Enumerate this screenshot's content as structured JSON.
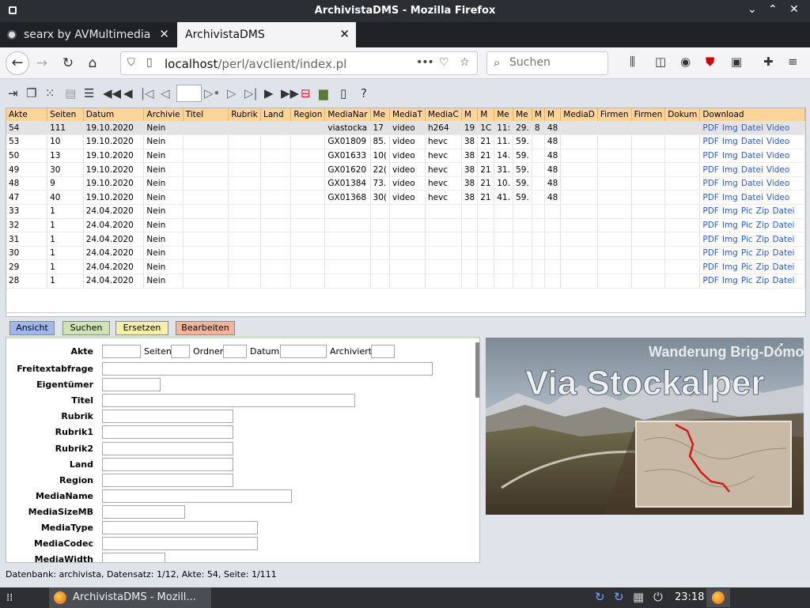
{
  "window": {
    "title": "ArchivistaDMS - Mozilla Firefox"
  },
  "tabs": [
    {
      "label": "searx by AVMultimedia",
      "active": false
    },
    {
      "label": "ArchivistaDMS",
      "active": true
    }
  ],
  "navbar": {
    "url_host": "localhost",
    "url_path": "/perl/avclient/index.pl",
    "search_placeholder": "Suchen",
    "more_label": "•••"
  },
  "toolbar": {
    "page_value": "",
    "help_label": "?"
  },
  "grid": {
    "columns": [
      "Akte",
      "Seiten",
      "Datum",
      "Archivie",
      "Titel",
      "Rubrik",
      "Land",
      "Region",
      "MediaNar",
      "Me",
      "MediaT",
      "MediaC",
      "M",
      "M",
      "Me",
      "Me",
      "M",
      "M",
      "MediaD",
      "Firmen",
      "Firmen",
      "Dokum",
      "Download"
    ],
    "rows": [
      {
        "selected": true,
        "cells": [
          "54",
          "111",
          "19.10.2020",
          "Nein",
          "",
          "",
          "",
          "",
          "viastocka",
          "17",
          "video",
          "h264",
          "19",
          "1C",
          "11:",
          "29.",
          "8",
          "48",
          "",
          "",
          "",
          ""
        ],
        "links": [
          "PDF",
          "Img",
          "Datei",
          "Video"
        ]
      },
      {
        "selected": false,
        "cells": [
          "53",
          "10",
          "19.10.2020",
          "Nein",
          "",
          "",
          "",
          "",
          "GX01809",
          "85.",
          "video",
          "hevc",
          "38",
          "21",
          "11.",
          "59.",
          "",
          "48",
          "",
          "",
          "",
          ""
        ],
        "links": [
          "PDF",
          "Img",
          "Datei",
          "Video"
        ]
      },
      {
        "selected": false,
        "cells": [
          "50",
          "13",
          "19.10.2020",
          "Nein",
          "",
          "",
          "",
          "",
          "GX01633",
          "10(",
          "video",
          "hevc",
          "38",
          "21",
          "14.",
          "59.",
          "",
          "48",
          "",
          "",
          "",
          ""
        ],
        "links": [
          "PDF",
          "Img",
          "Datei",
          "Video"
        ]
      },
      {
        "selected": false,
        "cells": [
          "49",
          "30",
          "19.10.2020",
          "Nein",
          "",
          "",
          "",
          "",
          "GX01620",
          "22(",
          "video",
          "hevc",
          "38",
          "21",
          "31.",
          "59.",
          "",
          "48",
          "",
          "",
          "",
          ""
        ],
        "links": [
          "PDF",
          "Img",
          "Datei",
          "Video"
        ]
      },
      {
        "selected": false,
        "cells": [
          "48",
          "9",
          "19.10.2020",
          "Nein",
          "",
          "",
          "",
          "",
          "GX01384",
          "73.",
          "video",
          "hevc",
          "38",
          "21",
          "10.",
          "59.",
          "",
          "48",
          "",
          "",
          "",
          ""
        ],
        "links": [
          "PDF",
          "Img",
          "Datei",
          "Video"
        ]
      },
      {
        "selected": false,
        "cells": [
          "47",
          "40",
          "19.10.2020",
          "Nein",
          "",
          "",
          "",
          "",
          "GX01368",
          "30(",
          "video",
          "hevc",
          "38",
          "21",
          "41.",
          "59.",
          "",
          "48",
          "",
          "",
          "",
          ""
        ],
        "links": [
          "PDF",
          "Img",
          "Datei",
          "Video"
        ]
      },
      {
        "selected": false,
        "cells": [
          "33",
          "1",
          "24.04.2020",
          "Nein",
          "",
          "",
          "",
          "",
          "",
          "",
          "",
          "",
          "",
          "",
          "",
          "",
          "",
          "",
          "",
          "",
          "",
          ""
        ],
        "links": [
          "PDF",
          "Img",
          "Pic",
          "Zip",
          "Datei"
        ]
      },
      {
        "selected": false,
        "cells": [
          "32",
          "1",
          "24.04.2020",
          "Nein",
          "",
          "",
          "",
          "",
          "",
          "",
          "",
          "",
          "",
          "",
          "",
          "",
          "",
          "",
          "",
          "",
          "",
          ""
        ],
        "links": [
          "PDF",
          "Img",
          "Pic",
          "Zip",
          "Datei"
        ]
      },
      {
        "selected": false,
        "cells": [
          "31",
          "1",
          "24.04.2020",
          "Nein",
          "",
          "",
          "",
          "",
          "",
          "",
          "",
          "",
          "",
          "",
          "",
          "",
          "",
          "",
          "",
          "",
          "",
          ""
        ],
        "links": [
          "PDF",
          "Img",
          "Pic",
          "Zip",
          "Datei"
        ]
      },
      {
        "selected": false,
        "cells": [
          "30",
          "1",
          "24.04.2020",
          "Nein",
          "",
          "",
          "",
          "",
          "",
          "",
          "",
          "",
          "",
          "",
          "",
          "",
          "",
          "",
          "",
          "",
          "",
          ""
        ],
        "links": [
          "PDF",
          "Img",
          "Pic",
          "Zip",
          "Datei"
        ]
      },
      {
        "selected": false,
        "cells": [
          "29",
          "1",
          "24.04.2020",
          "Nein",
          "",
          "",
          "",
          "",
          "",
          "",
          "",
          "",
          "",
          "",
          "",
          "",
          "",
          "",
          "",
          "",
          "",
          ""
        ],
        "links": [
          "PDF",
          "Img",
          "Pic",
          "Zip",
          "Datei"
        ]
      },
      {
        "selected": false,
        "cells": [
          "28",
          "1",
          "24.04.2020",
          "Nein",
          "",
          "",
          "",
          "",
          "",
          "",
          "",
          "",
          "",
          "",
          "",
          "",
          "",
          "",
          "",
          "",
          "",
          ""
        ],
        "links": [
          "PDF",
          "Img",
          "Pic",
          "Zip",
          "Datei"
        ]
      }
    ]
  },
  "form_tabs": [
    {
      "label": "Ansicht",
      "color": "#9fb8f0"
    },
    {
      "label": "Suchen",
      "color": "#cfe3b5"
    },
    {
      "label": "Ersetzen",
      "color": "#f7f0a8"
    },
    {
      "label": "Bearbeiten",
      "color": "#f5b49a"
    }
  ],
  "form": {
    "akte_label": "Akte",
    "seiten_label": "Seiten",
    "ordner_label": "Ordner",
    "datum_label": "Datum",
    "archiviert_label": "Archiviert",
    "fields": [
      {
        "label": "Freitextabfrage",
        "value": ""
      },
      {
        "label": "Eigentümer",
        "value": ""
      },
      {
        "label": "Titel",
        "value": ""
      },
      {
        "label": "Rubrik",
        "value": ""
      },
      {
        "label": "Rubrik1",
        "value": ""
      },
      {
        "label": "Rubrik2",
        "value": ""
      },
      {
        "label": "Land",
        "value": ""
      },
      {
        "label": "Region",
        "value": ""
      },
      {
        "label": "MediaName",
        "value": ""
      },
      {
        "label": "MediaSizeMB",
        "value": ""
      },
      {
        "label": "MediaType",
        "value": ""
      },
      {
        "label": "MediaCodec",
        "value": ""
      },
      {
        "label": "MediaWidth",
        "value": ""
      }
    ]
  },
  "preview": {
    "subtitle": "Wanderung Brig-Domodossola",
    "title": "Via Stockalper"
  },
  "status": {
    "text": "Datenbank: archivista, Datensatz: 1/12, Akte: 54, Seite: 1/111"
  },
  "taskbar": {
    "item_label": "ArchivistaDMS - Mozill...",
    "clock": "23:18"
  }
}
